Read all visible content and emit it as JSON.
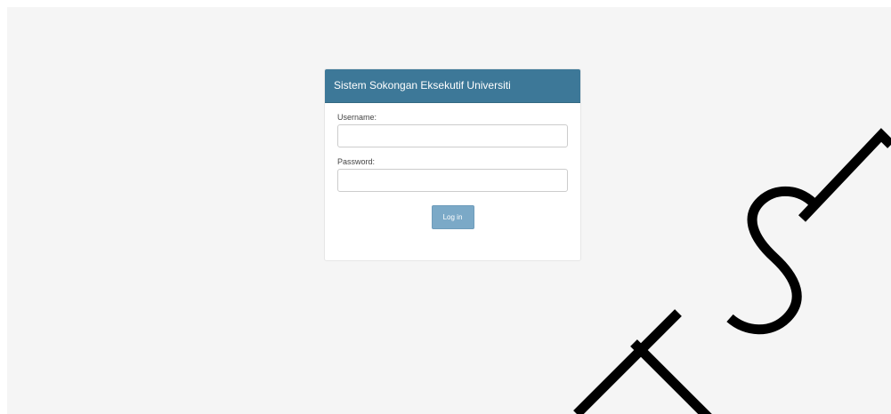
{
  "login": {
    "title": "Sistem Sokongan Eksekutif Universiti",
    "username_label": "Username:",
    "username_value": "",
    "password_label": "Password:",
    "password_value": "",
    "login_button": "Log in"
  },
  "watermark": {
    "text": "UTSM"
  },
  "colors": {
    "header_bg": "#3d7898",
    "button_bg": "#7ba9c7",
    "page_bg": "#f5f5f5",
    "watermark": "#000000"
  }
}
